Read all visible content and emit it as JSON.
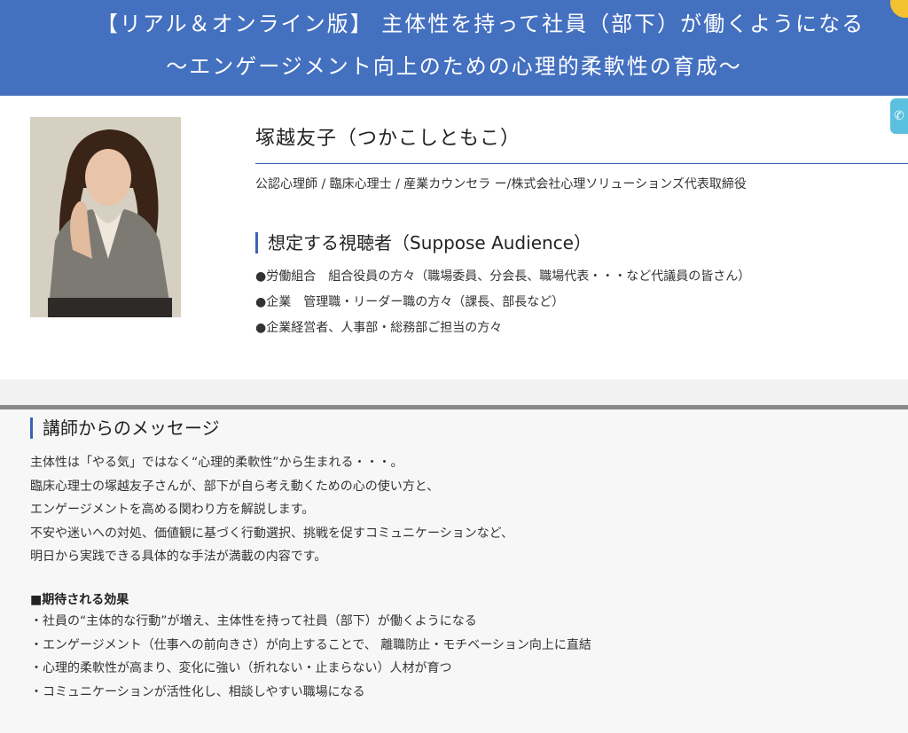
{
  "header": {
    "line1": "【リアル＆オンライン版】 主体性を持って社員（部下）が働くようになる",
    "line2": "〜エンゲージメント向上のための心理的柔軟性の育成〜"
  },
  "instructor": {
    "name": "塚越友子（つかこしともこ）",
    "credentials": "公認心理師 / 臨床心理士 / 産業カウンセラ ー/株式会社心理ソリューションズ代表取締役"
  },
  "audience": {
    "title": "想定する視聴者（Suppose Audience）",
    "items": [
      "●労働組合　組合役員の方々（職場委員、分会長、職場代表・・・など代議員の皆さん）",
      "●企業　管理職・リーダー職の方々（課長、部長など）",
      "●企業経営者、人事部・総務部ご担当の方々"
    ]
  },
  "message": {
    "title": "講師からのメッセージ",
    "lines": [
      "主体性は「やる気」ではなく“心理的柔軟性”から生まれる・・・。",
      "臨床心理士の塚越友子さんが、部下が自ら考え動くための心の使い方と、",
      "エンゲージメントを高める関わり方を解説します。",
      "不安や迷いへの対処、価値観に基づく行動選択、挑戦を促すコミュニケーションなど、",
      "明日から実践できる具体的な手法が満載の内容です。"
    ]
  },
  "effects": {
    "title": "■期待される効果",
    "items": [
      "・社員の“主体的な行動”が増え、主体性を持って社員（部下）が働くようになる",
      "・エンゲージメント（仕事への前向きさ）が向上することで、 離職防止・モチベーション向上に直結",
      "・心理的柔軟性が高まり、変化に強い（折れない・止まらない）人材が育つ",
      "・コミュニケーションが活性化し、相談しやすい職場になる"
    ]
  },
  "colors": {
    "header_bg": "#4470c0",
    "accent": "#3b63b3"
  },
  "icons": {
    "phone_tab": "phone-icon"
  }
}
